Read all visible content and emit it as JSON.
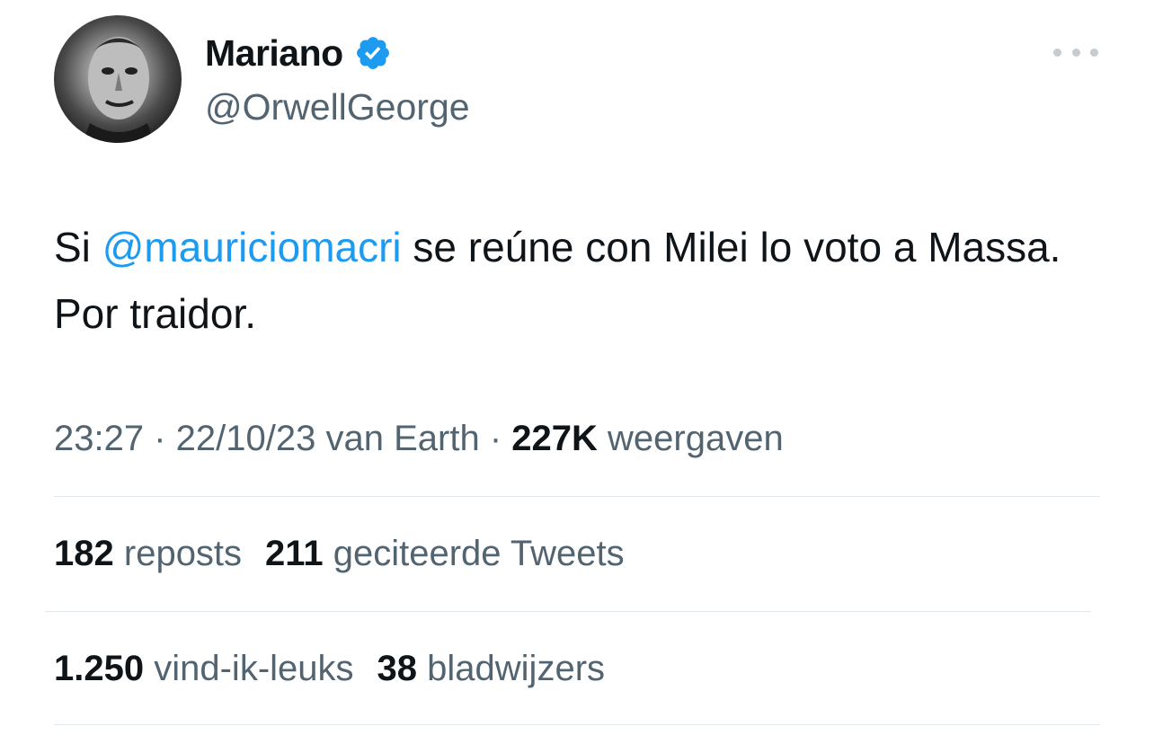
{
  "author": {
    "display_name": "Mariano",
    "handle": "@OrwellGeorge",
    "verified_icon": "verified-badge-icon",
    "avatar_icon": "avatar-image"
  },
  "tweet": {
    "text_before": "Si ",
    "mention": "@mauriciomacri",
    "text_after": " se reúne con Milei lo voto a Massa. Por traidor."
  },
  "meta": {
    "time": "23:27",
    "separator": " · ",
    "date": "22/10/23",
    "source": "van Earth",
    "views_count": "227K",
    "views_label": "weergaven"
  },
  "stats": {
    "reposts_count": "182",
    "reposts_label": "reposts",
    "quotes_count": "211",
    "quotes_label": "geciteerde Tweets",
    "likes_count": "1.250",
    "likes_label": "vind-ik-leuks",
    "bookmarks_count": "38",
    "bookmarks_label": "bladwijzers"
  },
  "colors": {
    "accent": "#1d9bf0",
    "text_primary": "#0f1419",
    "text_secondary": "#536471",
    "divider": "#e1e8ed"
  }
}
